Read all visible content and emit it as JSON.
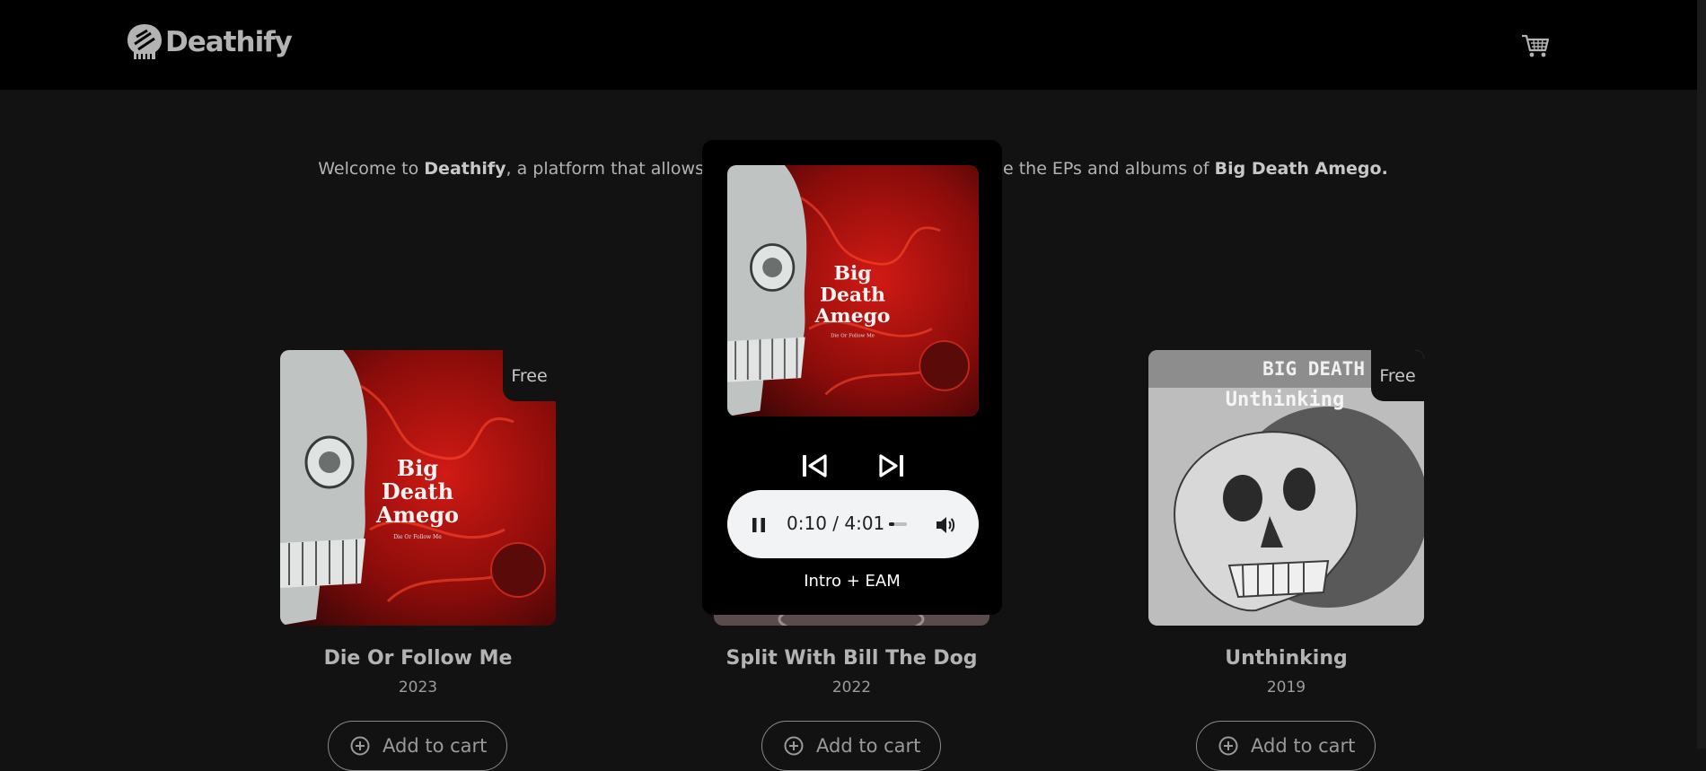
{
  "brand": {
    "name": "Deathify"
  },
  "header": {
    "cart_icon": "cart-icon"
  },
  "welcome": {
    "pre": "Welcome to ",
    "brand": "Deathify",
    "mid1": ", a platform that allows",
    "mid2": "e the EPs and albums of ",
    "band": "Big Death Amego."
  },
  "albums": [
    {
      "title": "Die Or Follow Me",
      "year": "2023",
      "badge": "Free",
      "button": "Add to cart",
      "cover_text": [
        "Big",
        "Death",
        "Amego"
      ],
      "cover_subtitle": "Die Or Follow Me"
    },
    {
      "title": "Split With Bill The Dog",
      "year": "2022",
      "button": "Add to cart"
    },
    {
      "title": "Unthinking",
      "year": "2019",
      "badge": "Free",
      "button": "Add to cart",
      "cover_text": [
        "BIG DEATH AMEGO",
        "Unthinking"
      ]
    }
  ],
  "player": {
    "time": "0:10 / 4:01",
    "progress_fraction": 0.04,
    "track": "Intro + EAM",
    "cover_text": [
      "Big",
      "Death",
      "Amego"
    ],
    "cover_subtitle": "Die Or Follow Me",
    "icons": [
      "previous-track-icon",
      "next-track-icon",
      "pause-icon",
      "volume-icon"
    ]
  },
  "colors": {
    "background": "#121212",
    "header": "#000000",
    "text": "#b3b3b3",
    "audio_bar": "#f1f3f4",
    "cover_red": "#b3120f"
  }
}
